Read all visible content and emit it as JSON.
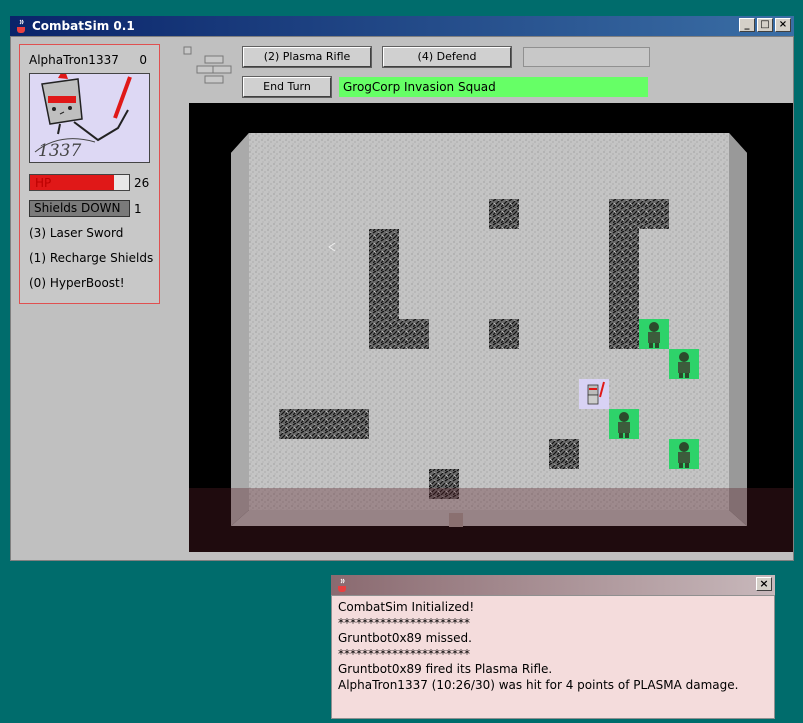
{
  "window": {
    "title": "CombatSim 0.1",
    "minimize_glyph": "_",
    "maximize_glyph": "□",
    "close_glyph": "×"
  },
  "player": {
    "name": "AlphaTron1337",
    "score": "0",
    "portrait_text": "1337",
    "hp_label": "HP",
    "hp_value": "26",
    "hp_fraction": 0.85,
    "shield_label": "Shields DOWN",
    "shield_value": "1",
    "abilities": [
      {
        "label": "(3) Laser Sword"
      },
      {
        "label": "(1) Recharge Shields"
      },
      {
        "label": "(0) HyperBoost!"
      }
    ]
  },
  "toolbar": {
    "plasma_rifle": "(2) Plasma Rifle",
    "defend": "(4) Defend",
    "end_turn": "End Turn",
    "squad_name": "GrogCorp Invasion Squad"
  },
  "log": {
    "close_glyph": "×",
    "lines": [
      "CombatSim Initialized!",
      "**********************",
      "Gruntbot0x89 missed.",
      "**********************",
      "Gruntbot0x89 fired its Plasma Rifle.",
      "AlphaTron1337 (10:26/30) was hit for 4 points of PLASMA damage."
    ]
  },
  "colors": {
    "desktop": "#006c6c",
    "enemy_tile": "#2ed36a",
    "hp_fill": "#e01818",
    "squad_bg": "#66ff66"
  },
  "icons": {
    "app": "java-cup-icon",
    "player_unit": "robot-knight-icon",
    "enemy_unit": "gruntbot-icon"
  }
}
